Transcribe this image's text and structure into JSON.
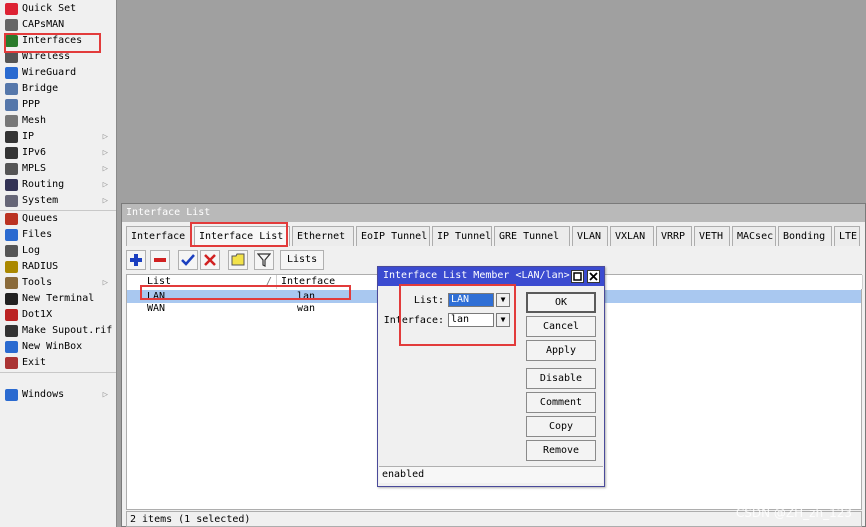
{
  "sidebar": {
    "items": [
      {
        "label": "Quick Set",
        "icon": "quick-set-icon",
        "has_submenu": false
      },
      {
        "label": "CAPsMAN",
        "icon": "capsman-icon",
        "has_submenu": false
      },
      {
        "label": "Interfaces",
        "icon": "interfaces-icon",
        "has_submenu": false
      },
      {
        "label": "Wireless",
        "icon": "wireless-icon",
        "has_submenu": false
      },
      {
        "label": "WireGuard",
        "icon": "wireguard-icon",
        "has_submenu": false
      },
      {
        "label": "Bridge",
        "icon": "bridge-icon",
        "has_submenu": false
      },
      {
        "label": "PPP",
        "icon": "ppp-icon",
        "has_submenu": false
      },
      {
        "label": "Mesh",
        "icon": "mesh-icon",
        "has_submenu": false
      },
      {
        "label": "IP",
        "icon": "ip-icon",
        "has_submenu": true
      },
      {
        "label": "IPv6",
        "icon": "ipv6-icon",
        "has_submenu": true
      },
      {
        "label": "MPLS",
        "icon": "mpls-icon",
        "has_submenu": true
      },
      {
        "label": "Routing",
        "icon": "routing-icon",
        "has_submenu": true
      },
      {
        "label": "System",
        "icon": "system-icon",
        "has_submenu": true
      },
      {
        "label": "Queues",
        "icon": "queues-icon",
        "has_submenu": false
      },
      {
        "label": "Files",
        "icon": "files-icon",
        "has_submenu": false
      },
      {
        "label": "Log",
        "icon": "log-icon",
        "has_submenu": false
      },
      {
        "label": "RADIUS",
        "icon": "radius-icon",
        "has_submenu": false
      },
      {
        "label": "Tools",
        "icon": "tools-icon",
        "has_submenu": true
      },
      {
        "label": "New Terminal",
        "icon": "terminal-icon",
        "has_submenu": false
      },
      {
        "label": "Dot1X",
        "icon": "dot1x-icon",
        "has_submenu": false
      },
      {
        "label": "Make Supout.rif",
        "icon": "supout-icon",
        "has_submenu": false
      },
      {
        "label": "New WinBox",
        "icon": "winbox-icon",
        "has_submenu": false
      },
      {
        "label": "Exit",
        "icon": "exit-icon",
        "has_submenu": false
      },
      {
        "label": "Windows",
        "icon": "windows-icon",
        "has_submenu": true
      }
    ],
    "arrow": "▷"
  },
  "interface_list_window": {
    "title": "Interface List",
    "tabs": [
      "Interface",
      "Interface List",
      "Ethernet",
      "EoIP Tunnel",
      "IP Tunnel",
      "GRE Tunnel",
      "VLAN",
      "VXLAN",
      "VRRP",
      "VETH",
      "MACsec",
      "Bonding",
      "LTE"
    ],
    "active_tab": "Interface List",
    "toolbar": {
      "icons": [
        "add-icon",
        "remove-icon",
        "enable-check-icon",
        "disable-x-icon",
        "comment-icon",
        "filter-icon"
      ],
      "lists_label": "Lists"
    },
    "columns": [
      "List",
      "/",
      "Interface"
    ],
    "rows": [
      {
        "list": "LAN",
        "interface": "lan",
        "selected": true
      },
      {
        "list": "WAN",
        "interface": "wan",
        "selected": false
      }
    ],
    "status": "2 items (1 selected)"
  },
  "member_dialog": {
    "title": "Interface List Member <LAN/lan>",
    "list_label": "List:",
    "list_value": "LAN",
    "interface_label": "Interface:",
    "interface_value": "lan",
    "buttons": {
      "ok": "OK",
      "cancel": "Cancel",
      "apply": "Apply",
      "disable": "Disable",
      "comment": "Comment",
      "copy": "Copy",
      "remove": "Remove"
    },
    "status": "enabled"
  },
  "watermark": "CSDN @ZH_zh_123",
  "colors": {
    "highlight": "#e23b3b",
    "dialog_title": "#3b4bd0",
    "selected_row": "#a9c8f0",
    "desktop": "#a0a0a0"
  }
}
